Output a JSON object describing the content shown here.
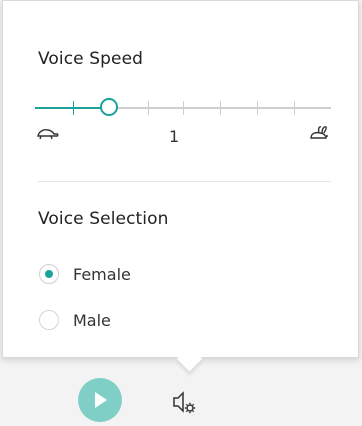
{
  "panel": {
    "voice_speed": {
      "title": "Voice Speed",
      "value": "1",
      "slider_fraction": 0.25,
      "slow_icon": "turtle-icon",
      "fast_icon": "rabbit-icon"
    },
    "voice_selection": {
      "title": "Voice Selection",
      "options": [
        {
          "label": "Female",
          "selected": true
        },
        {
          "label": "Male",
          "selected": false
        }
      ]
    }
  },
  "toolbar": {
    "play_icon": "play-icon",
    "settings_icon": "voice-settings-icon"
  },
  "colors": {
    "accent": "#1aa39a",
    "play_bg": "#7fcfc6"
  }
}
